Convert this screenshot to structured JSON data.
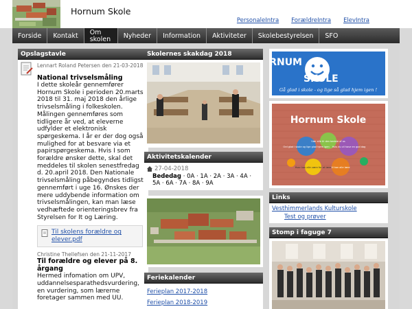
{
  "header": {
    "title": "Hornum Skole",
    "links": [
      "PersonaleIntra",
      "ForældreIntra",
      "ElevIntra"
    ]
  },
  "nav": {
    "items": [
      "Forside",
      "Kontakt",
      "Om skolen",
      "Nyheder",
      "Information",
      "Aktiviteter",
      "Skolebestyrelsen",
      "SFO"
    ],
    "active": "Om skolen"
  },
  "opslagstavle": {
    "heading": "Opslagstavle",
    "post1": {
      "byline": "Lennart Roland Petersen den 21-03-2018",
      "title": "National trivselsmåling",
      "text": "I dette skoleår gennemfører Hornum Skole i perioden 20.marts 2018 til 31. maj 2018 den årlige trivselsmåling i folkeskolen. Målingen gennemføres som tidligere år ved, at eleverne udfylder et elektronisk spørgeskema. I år er der dog også mulighed for at besvare via et papirspørgeskema. Hvis I som forældre ønsker dette, skal det meddeles til skolen senestfredag d. 20.april 2018. Den Nationale trivselsmåling påbegyndes tidligst gennemført i uge 16. Ønskes der mere uddybende information om trivselsmålingen, kan man læse vedhæftede orienteringsbrev fra Styrelsen for It og Læring.",
      "attachment": "Til skolens forældre og elever.pdf"
    },
    "post2": {
      "byline": "Christine Thellefsen den 21-11-2017",
      "title": "Til forældre og elever på 8. årgang",
      "text": "Hermed infomation om UPV, uddannelsesparathedsvurdering, en vurdering, som lærerne foretager sammen med UU."
    }
  },
  "skakdag": {
    "heading": "Skolernes skakdag 2018"
  },
  "aktivitet": {
    "heading": "Aktivitetskalender",
    "date": "27-04-2018",
    "title": "Bededag",
    "classes": "· 0A · 1A · 2A · 3A · 4A · 5A · 6A · 7A · 8A · 9A"
  },
  "feriekalender": {
    "heading": "Feriekalender",
    "links": [
      "Ferieplan 2017-2018",
      "Ferieplan 2018-2019"
    ]
  },
  "logo": {
    "word1": "HORNUM",
    "word2": "SKOLE",
    "slogan": "Gå glad i skole - og lige så glad hjem igen !"
  },
  "wall_sign": {
    "text": "Hornum Skole",
    "bubbles": [
      "Ord glad i skole og lige glad hjem igen",
      "Vær alle til den bedste af os",
      "Hvis du vil have en god dag",
      "Hvor kan alle være for at lære",
      "Vi kan alle lære"
    ]
  },
  "links_box": {
    "heading": "Links",
    "items": [
      "Vesthimmerlands Kulturskole",
      "Test og prøver"
    ]
  },
  "stomp": {
    "heading": "Stomp i faguge 7"
  },
  "colors": {
    "nav_bg": "#2b2b2b",
    "link": "#1f4fa8",
    "logo_blue": "#2a73c9"
  }
}
